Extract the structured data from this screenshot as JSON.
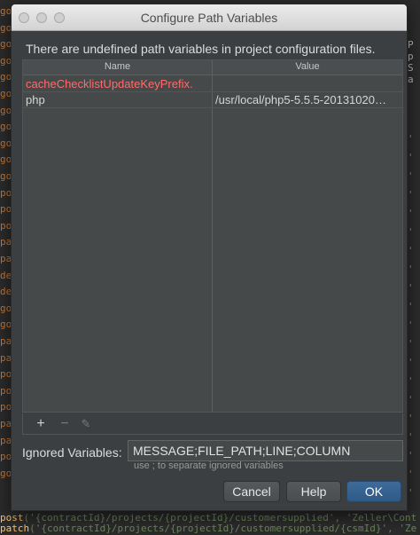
{
  "dialog": {
    "title": "Configure Path Variables",
    "message": "There are undefined path variables in project configuration files."
  },
  "table": {
    "columns": [
      "Name",
      "Value"
    ],
    "rows": [
      {
        "name": "cacheChecklistUpdateKeyPrefix.",
        "value": "",
        "undefined": true
      },
      {
        "name": "php",
        "value": "/usr/local/php5-5.5.5-20131020…",
        "undefined": false
      }
    ]
  },
  "toolbar": {
    "add": "+",
    "remove": "−",
    "edit": "✎"
  },
  "ignored": {
    "label": "Ignored Variables:",
    "value": "MESSAGE;FILE_PATH;LINE;COLUMN",
    "hint": "use ; to separate ignored variables"
  },
  "buttons": {
    "cancel": "Cancel",
    "help": "Help",
    "ok": "OK"
  },
  "editor": {
    "gutter": [
      "go",
      "go",
      "go",
      "go",
      "go",
      "go",
      "go",
      "go",
      "go",
      "go",
      "go",
      "po",
      "po",
      "po",
      "pa",
      "pa",
      "de",
      "de",
      "go",
      "go",
      "pa",
      "pa",
      "po",
      "po",
      "po",
      "pa",
      "pa",
      "po",
      "go"
    ],
    "right_top": [
      "P",
      "p",
      "S",
      "a"
    ],
    "right": [
      "'",
      "'",
      "'",
      "'",
      "'",
      "'",
      "'",
      "'",
      "'",
      "'",
      "'",
      "'",
      "'",
      "'",
      "'",
      "'",
      "'",
      "'",
      "'",
      "'"
    ],
    "bottom_lines": [
      {
        "fn": "post",
        "text": "('{contractId}/projects/{projectId}/customersupplied', 'Zeller\\Cont"
      },
      {
        "fn": "patch",
        "text": "('{contractId}/projects/{projectId}/customersupplied/{csmId}', 'Ze"
      }
    ]
  },
  "colors": {
    "accent": "#2f5a86",
    "undefined_text": "#ff6b6b",
    "dialog_bg": "#3c3f41"
  }
}
